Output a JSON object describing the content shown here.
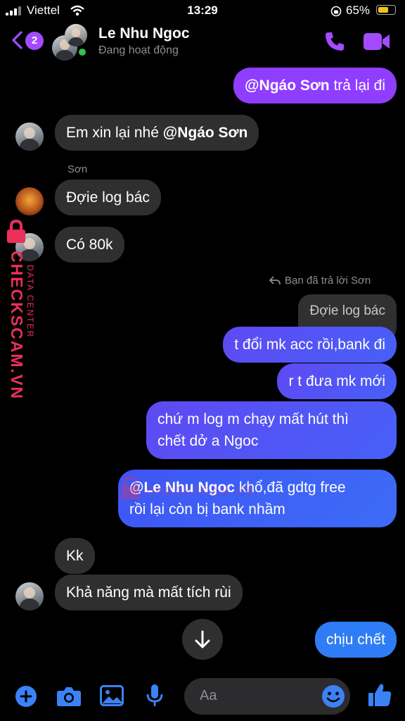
{
  "status_bar": {
    "carrier": "Viettel",
    "time": "13:29",
    "battery": "65%",
    "battery_level": 0.65
  },
  "header": {
    "badge_count": "2",
    "contact_name": "Le Nhu Ngoc",
    "contact_status": "Đang hoạt động"
  },
  "messages": {
    "m1_mention": "@Ngáo Sơn",
    "m1_text": " trả lại đi",
    "m2_text": "Em xin lại nhé ",
    "m2_mention": "@Ngáo Sơn",
    "m3_sender": "Sơn",
    "m3_text": "Đợie log bác",
    "m4_text": "Có 80k",
    "reply_note": "Bạn đã trả lời Sơn",
    "quoted_text": "Đợie log bác",
    "m5_text": "t đổi mk acc rồi,bank đi",
    "m6_text": "r t đưa mk mới",
    "m7_line1": "chứ m log m chạy mất hút thì",
    "m7_line2": "chết dở a Ngoc",
    "m8_mention": "@Le Nhu Ngoc",
    "m8_line1": " khổ,đã gdtg free",
    "m8_line2": "rồi lại còn bị bank nhầm",
    "m9_text": "Kk",
    "m10_text": "Khả năng mà mất tích rùi",
    "m11_text": "chịu chết"
  },
  "watermark": {
    "brand": "CHECKSCAM.VN",
    "sub": "DATA CENTER"
  },
  "composer": {
    "placeholder": "Aa"
  },
  "colors": {
    "accent": "#a34bff",
    "outgoing_start": "#5f49f2",
    "outgoing_end": "#4660f8",
    "incoming": "#2f2f2f",
    "watermark": "#ea2f5b"
  }
}
